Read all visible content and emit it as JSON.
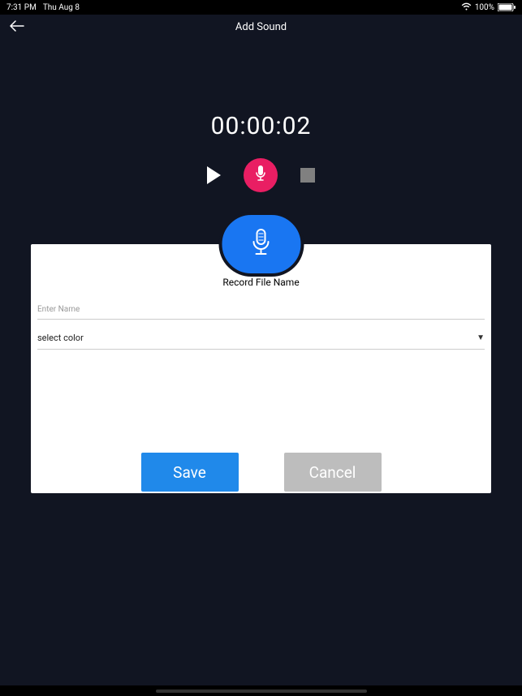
{
  "statusbar": {
    "time": "7:31 PM",
    "date": "Thu Aug 8",
    "battery_pct": "100%"
  },
  "header": {
    "title": "Add Sound"
  },
  "recorder": {
    "timer": "00:00:02"
  },
  "modal": {
    "title": "Record File Name",
    "name_placeholder": "Enter Name",
    "color_select_label": "select color",
    "save_label": "Save",
    "cancel_label": "Cancel"
  }
}
